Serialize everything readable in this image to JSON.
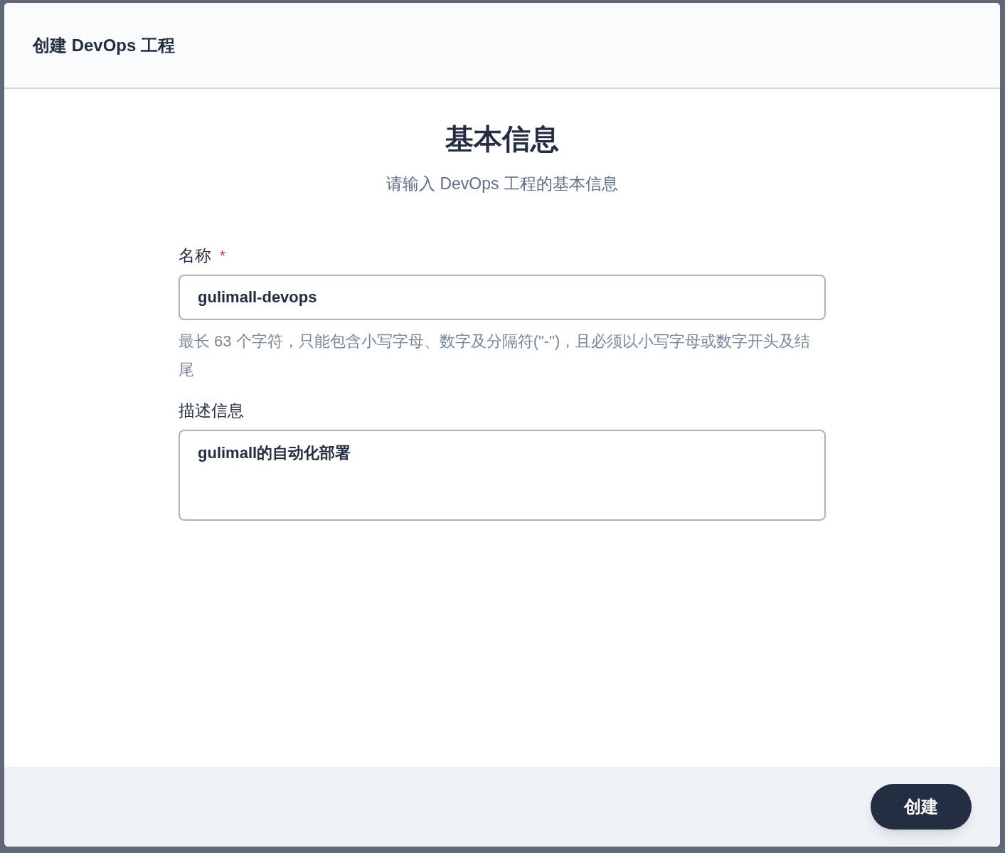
{
  "dialog": {
    "title": "创建 DevOps 工程"
  },
  "section": {
    "title": "基本信息",
    "subtitle": "请输入 DevOps 工程的基本信息"
  },
  "fields": [
    {
      "kind": "input",
      "label": "名称",
      "required_marker": "*",
      "value": "gulimall-devops",
      "hint": "最长 63 个字符，只能包含小写字母、数字及分隔符(\"-\")，且必须以小写字母或数字开头及结尾"
    },
    {
      "kind": "textarea",
      "label": "描述信息",
      "value": "gulimall的自动化部署"
    }
  ],
  "buttons": [
    {
      "label": "创建"
    }
  ]
}
